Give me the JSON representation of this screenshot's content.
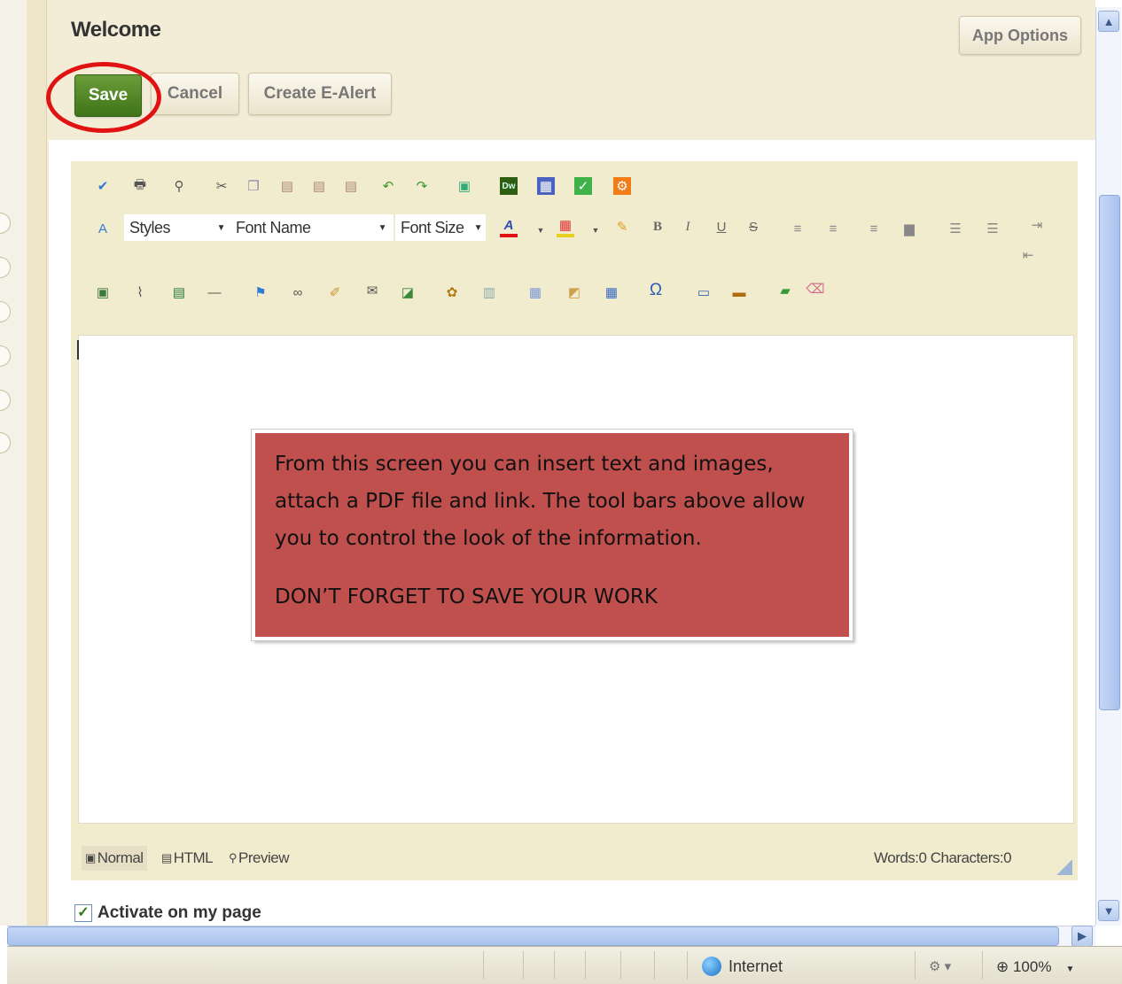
{
  "header": {
    "title": "Welcome",
    "app_options_label": "App Options"
  },
  "actions": {
    "save_label": "Save",
    "cancel_label": "Cancel",
    "create_alert_label": "Create E-Alert"
  },
  "toolbar": {
    "styles": "Styles",
    "font_name": "Font Name",
    "font_size": "Font Size",
    "bold": "B",
    "italic": "I",
    "underline": "U",
    "strike": "S",
    "omega": "Ω",
    "dw": "Dw"
  },
  "callout": {
    "text": "From this screen you can insert text and images, attach a PDF file and link. The tool bars above allow you to control the look of the information.",
    "warning": "DON’T FORGET TO SAVE YOUR WORK"
  },
  "modes": {
    "normal": "Normal",
    "html": "HTML",
    "preview": "Preview",
    "counts": "Words:0 Characters:0"
  },
  "activate_label": "Activate on my page",
  "statusbar": {
    "zone": "Internet",
    "zoom": "100%"
  },
  "colors": {
    "save_green": "#4a8520",
    "callout_red": "#c0504d",
    "annotation_ring": "#e01212",
    "panel_beige": "#f2eccf"
  }
}
